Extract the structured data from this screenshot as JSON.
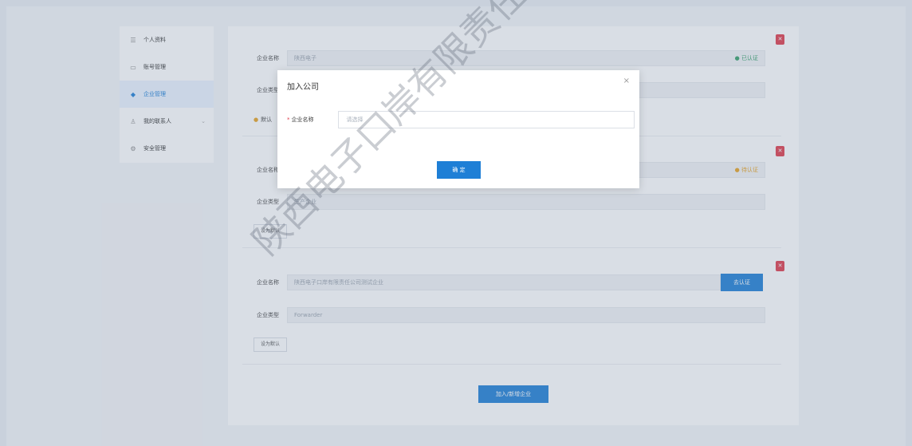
{
  "sidebar": {
    "items": [
      {
        "icon": "user-icon",
        "label": "个人资料"
      },
      {
        "icon": "account-icon",
        "label": "账号管理"
      },
      {
        "icon": "company-icon",
        "label": "企业管理"
      },
      {
        "icon": "contact-icon",
        "label": "我的联系人"
      },
      {
        "icon": "settings-icon",
        "label": "安全管理"
      }
    ]
  },
  "cards": [
    {
      "name_label": "企业名称",
      "name_value": "陕西电子",
      "status": "已认证",
      "type_label": "企业类型",
      "type_value": "",
      "default_label": "默认"
    },
    {
      "name_label": "企业名称",
      "name_value": "",
      "status": "待认证",
      "type_label": "企业类型",
      "type_value": "生产企业",
      "button": "设为默认"
    },
    {
      "name_label": "企业名称",
      "name_value": "陕西电子口岸有限责任公司测试企业",
      "action_button": "去认证",
      "type_label": "企业类型",
      "type_value": "Forwarder",
      "button": "设为默认"
    }
  ],
  "bottom_button": "加入/新增企业",
  "modal": {
    "title": "加入公司",
    "close": "×",
    "field_label": "企业名称",
    "required_mark": "*",
    "placeholder": "请选择",
    "confirm": "确 定"
  },
  "watermark": "陕西电子口岸有限责任公司"
}
